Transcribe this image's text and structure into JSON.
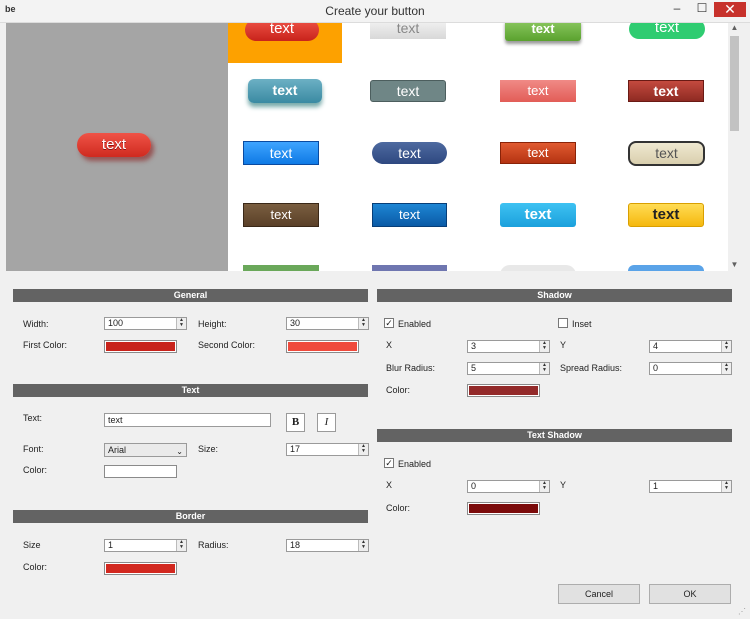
{
  "window": {
    "app_icon": "be",
    "title": "Create your button",
    "min_glyph": "–",
    "max_glyph": "☐",
    "close_glyph": "✕"
  },
  "preview": {
    "label": "text"
  },
  "gallery": {
    "buttons": [
      {
        "label": "text"
      },
      {
        "label": "text"
      },
      {
        "label": "text"
      },
      {
        "label": "text"
      },
      {
        "label": "text"
      },
      {
        "label": "text"
      },
      {
        "label": "text"
      },
      {
        "label": "text"
      },
      {
        "label": "text"
      },
      {
        "label": "text"
      },
      {
        "label": "text"
      },
      {
        "label": "text"
      },
      {
        "label": "text"
      },
      {
        "label": "text"
      },
      {
        "label": "text"
      },
      {
        "label": "text"
      }
    ]
  },
  "general": {
    "header": "General",
    "width_label": "Width:",
    "width_value": "100",
    "height_label": "Height:",
    "height_value": "30",
    "first_color_label": "First Color:",
    "first_color": "#c8231b",
    "second_color_label": "Second Color:",
    "second_color": "#ef4a3c"
  },
  "text": {
    "header": "Text",
    "text_label": "Text:",
    "text_value": "text",
    "bold_label": "B",
    "italic_label": "I",
    "font_label": "Font:",
    "font_value": "Arial",
    "size_label": "Size:",
    "size_value": "17",
    "color_label": "Color:",
    "color": "#ffffff"
  },
  "border": {
    "header": "Border",
    "size_label": "Size",
    "size_value": "1",
    "radius_label": "Radius:",
    "radius_value": "18",
    "color_label": "Color:",
    "color": "#d2281f"
  },
  "shadow": {
    "header": "Shadow",
    "enabled_label": "Enabled",
    "enabled": true,
    "inset_label": "Inset",
    "inset": false,
    "x_label": "X",
    "x_value": "3",
    "y_label": "Y",
    "y_value": "4",
    "blur_label": "Blur Radius:",
    "blur_value": "5",
    "spread_label": "Spread Radius:",
    "spread_value": "0",
    "color_label": "Color:",
    "color": "#932a2a"
  },
  "text_shadow": {
    "header": "Text Shadow",
    "enabled_label": "Enabled",
    "enabled": true,
    "x_label": "X",
    "x_value": "0",
    "y_label": "Y",
    "y_value": "1",
    "color_label": "Color:",
    "color": "#7b0a0a"
  },
  "dialog": {
    "cancel_label": "Cancel",
    "ok_label": "OK"
  }
}
